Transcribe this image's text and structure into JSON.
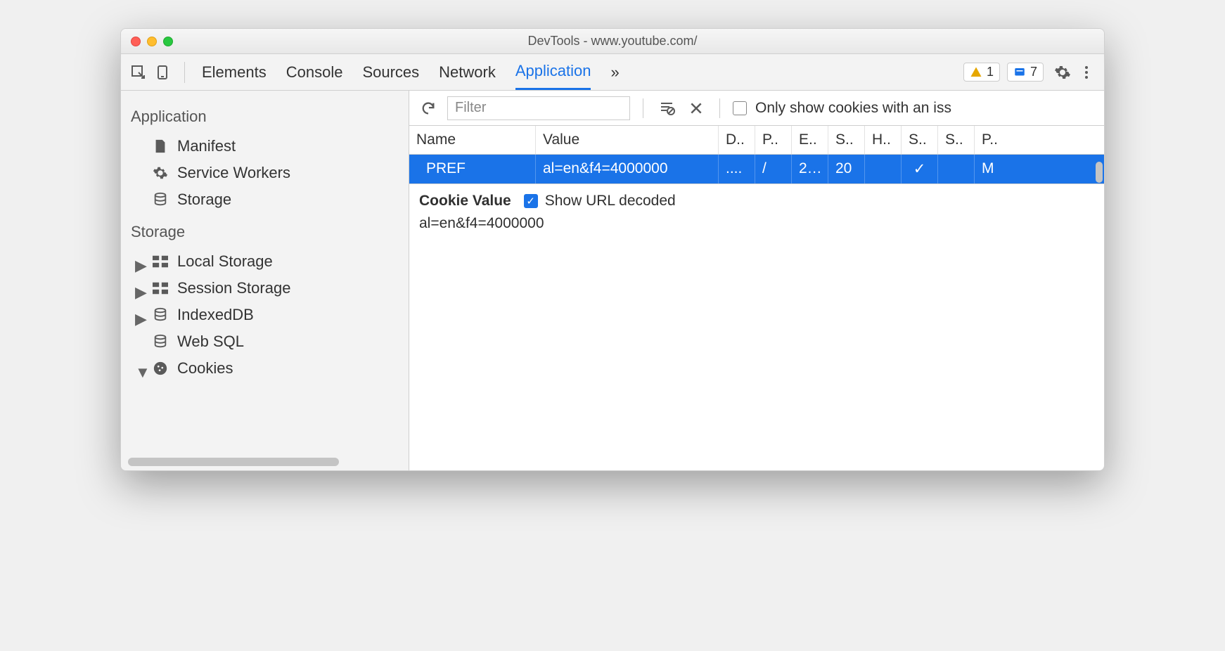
{
  "window": {
    "title": "DevTools - www.youtube.com/"
  },
  "toolbar": {
    "tabs": [
      "Elements",
      "Console",
      "Sources",
      "Network",
      "Application"
    ],
    "active_tab": "Application",
    "more": "»",
    "warn_count": "1",
    "msg_count": "7"
  },
  "sidebar": {
    "app_heading": "Application",
    "app_items": [
      {
        "label": "Manifest",
        "icon": "file"
      },
      {
        "label": "Service Workers",
        "icon": "gear"
      },
      {
        "label": "Storage",
        "icon": "db"
      }
    ],
    "storage_heading": "Storage",
    "storage_items": [
      {
        "label": "Local Storage",
        "icon": "grid",
        "arrow": true
      },
      {
        "label": "Session Storage",
        "icon": "grid",
        "arrow": true
      },
      {
        "label": "IndexedDB",
        "icon": "db",
        "arrow": true
      },
      {
        "label": "Web SQL",
        "icon": "db",
        "arrow": false
      },
      {
        "label": "Cookies",
        "icon": "cookie",
        "arrow": true,
        "open": true
      }
    ]
  },
  "main_toolbar": {
    "filter_placeholder": "Filter",
    "only_label": "Only show cookies with an iss"
  },
  "table": {
    "headers": [
      "Name",
      "Value",
      "D..",
      "P..",
      "E..",
      "S..",
      "H..",
      "S..",
      "S..",
      "P.."
    ],
    "row": {
      "name": "PREF",
      "value": "al=en&f4=4000000",
      "d": "....",
      "p": "/",
      "e": "2…",
      "s": "20",
      "h": "",
      "s2": "✓",
      "s3": "",
      "pr": "M"
    }
  },
  "detail": {
    "label": "Cookie Value",
    "checkbox_label": "Show URL decoded",
    "value": "al=en&f4=4000000"
  }
}
